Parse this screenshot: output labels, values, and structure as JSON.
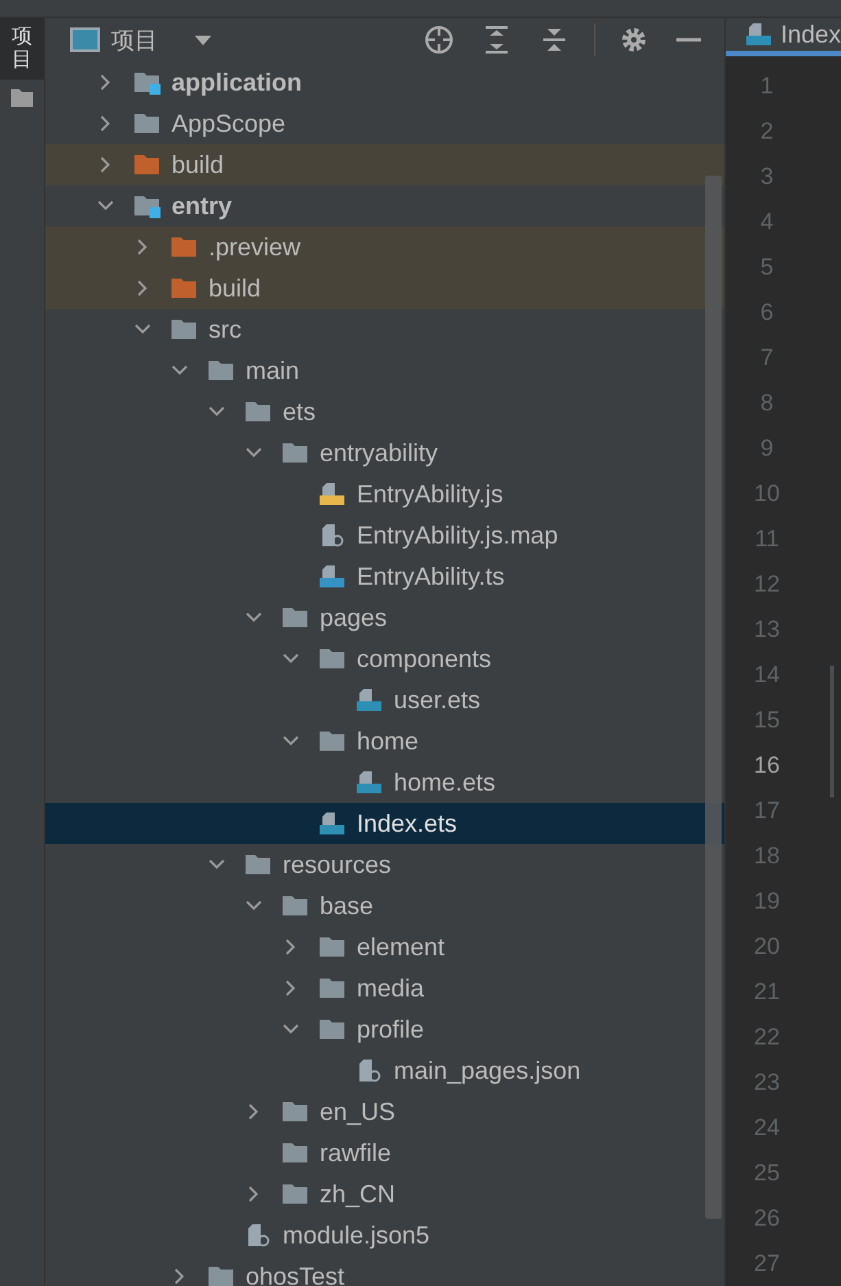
{
  "tool_strip": {
    "tabs": [
      {
        "label": "项目",
        "selected": true
      }
    ]
  },
  "panel": {
    "title": "项目"
  },
  "tree": [
    {
      "name": "application",
      "kind": "module",
      "expanded": false,
      "selected": false
    },
    {
      "name": "AppScope",
      "kind": "folder",
      "expanded": false,
      "selected": false
    },
    {
      "name": "build",
      "kind": "excluded",
      "expanded": false,
      "selected": false
    },
    {
      "name": "entry",
      "kind": "module",
      "expanded": true,
      "selected": false,
      "children": [
        {
          "name": ".preview",
          "kind": "excluded",
          "expanded": false,
          "selected": false
        },
        {
          "name": "build",
          "kind": "excluded",
          "expanded": false,
          "selected": false
        },
        {
          "name": "src",
          "kind": "folder",
          "expanded": true,
          "selected": false,
          "children": [
            {
              "name": "main",
              "kind": "folder",
              "expanded": true,
              "selected": false,
              "children": [
                {
                  "name": "ets",
                  "kind": "folder",
                  "expanded": true,
                  "selected": false,
                  "children": [
                    {
                      "name": "entryability",
                      "kind": "folder",
                      "expanded": true,
                      "selected": false,
                      "children": [
                        {
                          "name": "EntryAbility.js",
                          "kind": "js",
                          "selected": false
                        },
                        {
                          "name": "EntryAbility.js.map",
                          "kind": "json",
                          "selected": false
                        },
                        {
                          "name": "EntryAbility.ts",
                          "kind": "ts",
                          "selected": false
                        }
                      ]
                    },
                    {
                      "name": "pages",
                      "kind": "folder",
                      "expanded": true,
                      "selected": false,
                      "children": [
                        {
                          "name": "components",
                          "kind": "folder",
                          "expanded": true,
                          "selected": false,
                          "children": [
                            {
                              "name": "user.ets",
                              "kind": "ets",
                              "selected": false
                            }
                          ]
                        },
                        {
                          "name": "home",
                          "kind": "folder",
                          "expanded": true,
                          "selected": false,
                          "children": [
                            {
                              "name": "home.ets",
                              "kind": "ets",
                              "selected": false
                            }
                          ]
                        },
                        {
                          "name": "Index.ets",
                          "kind": "ets",
                          "selected": true
                        }
                      ]
                    }
                  ]
                },
                {
                  "name": "resources",
                  "kind": "folder",
                  "expanded": true,
                  "selected": false,
                  "children": [
                    {
                      "name": "base",
                      "kind": "folder",
                      "expanded": true,
                      "selected": false,
                      "children": [
                        {
                          "name": "element",
                          "kind": "folder",
                          "expanded": false,
                          "selected": false
                        },
                        {
                          "name": "media",
                          "kind": "folder",
                          "expanded": false,
                          "selected": false
                        },
                        {
                          "name": "profile",
                          "kind": "folder",
                          "expanded": true,
                          "selected": false,
                          "children": [
                            {
                              "name": "main_pages.json",
                              "kind": "json",
                              "selected": false
                            }
                          ]
                        }
                      ]
                    },
                    {
                      "name": "en_US",
                      "kind": "folder",
                      "expanded": false,
                      "selected": false
                    },
                    {
                      "name": "rawfile",
                      "kind": "folder",
                      "selected": false
                    },
                    {
                      "name": "zh_CN",
                      "kind": "folder",
                      "expanded": false,
                      "selected": false
                    }
                  ]
                },
                {
                  "name": "module.json5",
                  "kind": "json",
                  "selected": false
                }
              ]
            },
            {
              "name": "ohosTest",
              "kind": "folder",
              "expanded": false,
              "selected": false
            }
          ]
        }
      ]
    }
  ],
  "editor": {
    "tab": {
      "label": "Index",
      "selected": true
    },
    "lines": [
      {
        "number": "1",
        "current": false
      },
      {
        "number": "2",
        "current": false
      },
      {
        "number": "3",
        "current": false
      },
      {
        "number": "4",
        "current": false
      },
      {
        "number": "5",
        "current": false
      },
      {
        "number": "6",
        "current": false
      },
      {
        "number": "7",
        "current": false
      },
      {
        "number": "8",
        "current": false
      },
      {
        "number": "9",
        "current": false
      },
      {
        "number": "10",
        "current": false
      },
      {
        "number": "11",
        "current": false
      },
      {
        "number": "12",
        "current": false
      },
      {
        "number": "13",
        "current": false
      },
      {
        "number": "14",
        "current": false
      },
      {
        "number": "15",
        "current": false
      },
      {
        "number": "16",
        "current": true
      },
      {
        "number": "17",
        "current": false
      },
      {
        "number": "18",
        "current": false
      },
      {
        "number": "19",
        "current": false
      },
      {
        "number": "20",
        "current": false
      },
      {
        "number": "21",
        "current": false
      },
      {
        "number": "22",
        "current": false
      },
      {
        "number": "23",
        "current": false
      },
      {
        "number": "24",
        "current": false
      },
      {
        "number": "25",
        "current": false
      },
      {
        "number": "26",
        "current": false
      },
      {
        "number": "27",
        "current": false
      }
    ]
  }
}
